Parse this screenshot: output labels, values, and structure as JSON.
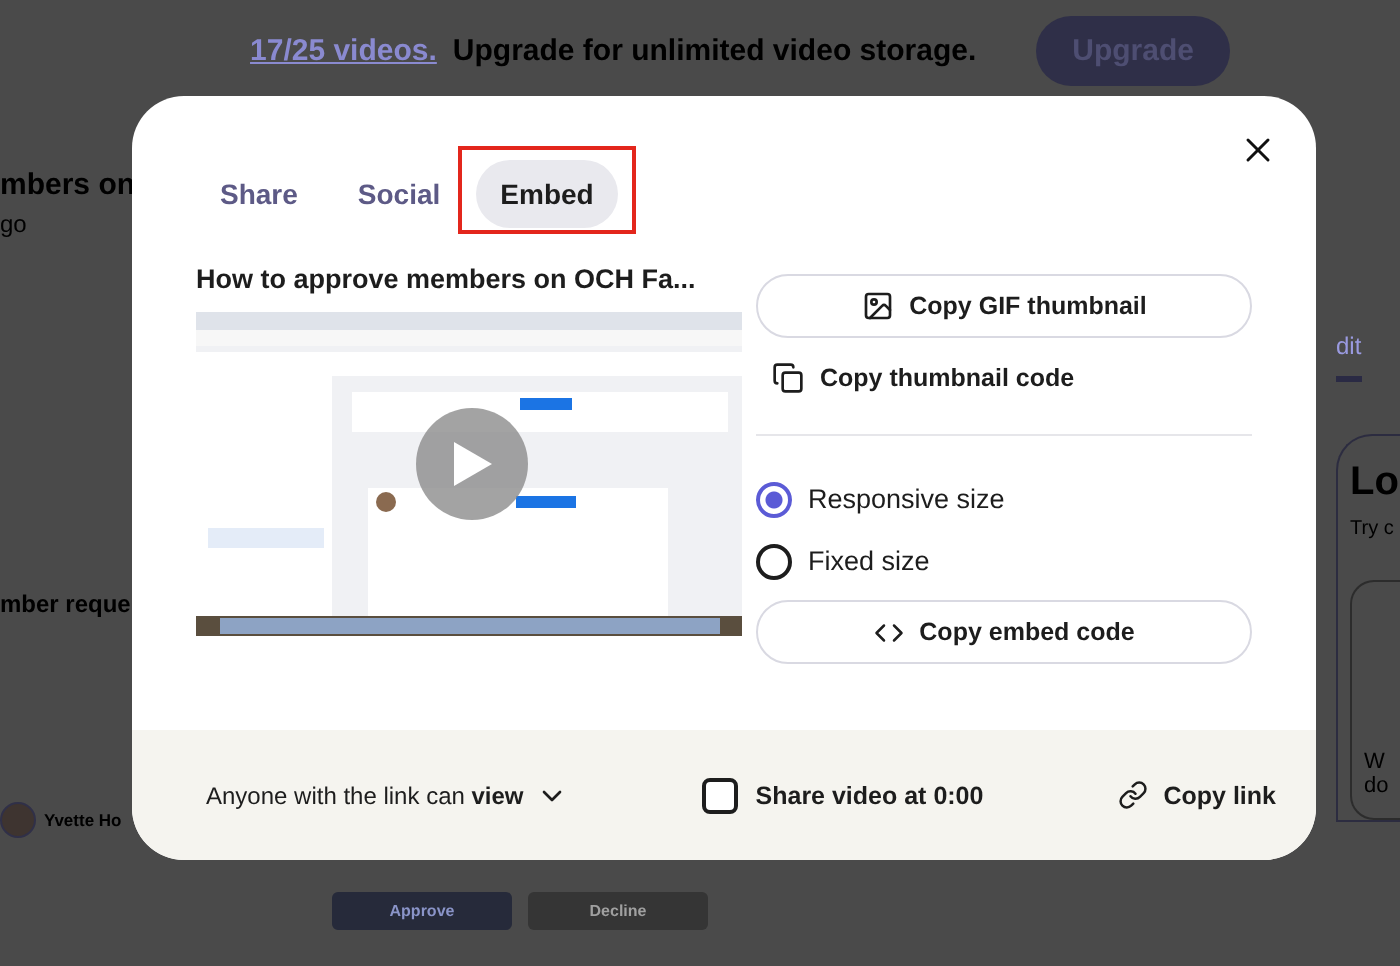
{
  "background": {
    "banner": {
      "count_link": "17/25 videos.",
      "message": "Upgrade for unlimited video storage.",
      "button": "Upgrade"
    },
    "left": {
      "title": "mbers on",
      "subtitle": "go",
      "section": "mber reque",
      "member_name": "Yvette Ho"
    },
    "right": {
      "tab": "dit",
      "heading": "Lo",
      "hint": "Try c",
      "card_lines": [
        "W",
        "do"
      ]
    },
    "actions": [
      "Approve",
      "Decline"
    ]
  },
  "dialog": {
    "tabs": [
      {
        "label": "Share",
        "selected": false,
        "highlighted": false
      },
      {
        "label": "Social",
        "selected": false,
        "highlighted": false
      },
      {
        "label": "Embed",
        "selected": true,
        "highlighted": true
      }
    ],
    "video_title": "How to approve members on OCH Fa...",
    "thumbnail_actions": [
      {
        "label": "Copy GIF thumbnail",
        "kind": "button"
      },
      {
        "label": "Copy thumbnail code",
        "kind": "link"
      }
    ],
    "size_options": [
      {
        "label": "Responsive size",
        "selected": true
      },
      {
        "label": "Fixed size",
        "selected": false
      }
    ],
    "embed_button": "Copy embed code",
    "footer": {
      "permission": "Anyone with the link can **view**",
      "share_at": {
        "label": "Share video at 0:00",
        "checked": false
      },
      "copy_link": "Copy link"
    }
  }
}
